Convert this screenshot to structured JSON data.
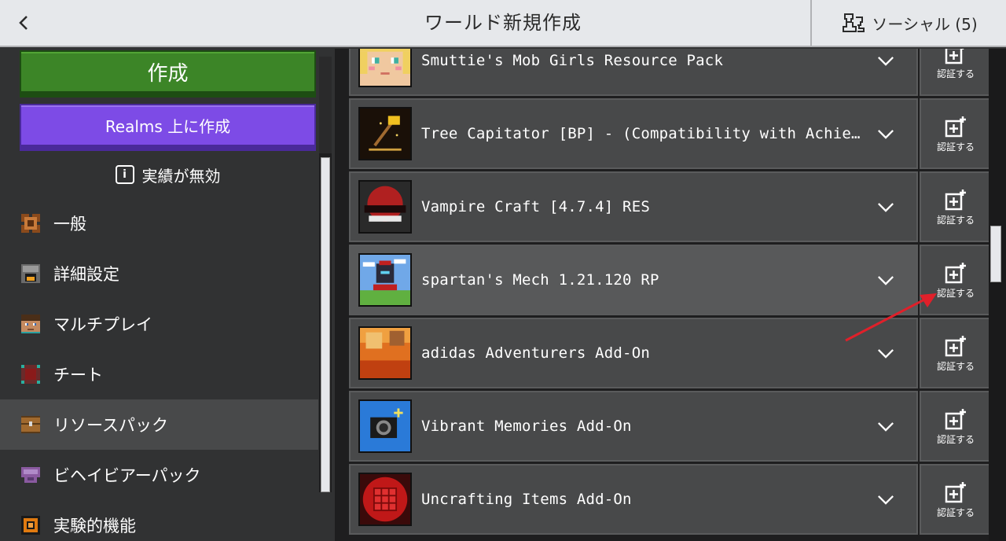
{
  "header": {
    "title": "ワールド新規作成",
    "social_label": "ソーシャル (5)"
  },
  "left": {
    "create_label": "作成",
    "realms_label": "Realms 上に作成",
    "achievements_label": "実績が無効",
    "achievements_icon": "info-icon",
    "nav": [
      {
        "label": "一般",
        "icon": "gear-icon",
        "active": false
      },
      {
        "label": "詳細設定",
        "icon": "furnace-icon",
        "active": false
      },
      {
        "label": "マルチプレイ",
        "icon": "player-head-icon",
        "active": false
      },
      {
        "label": "チート",
        "icon": "cheat-block-icon",
        "active": false
      },
      {
        "label": "リソースパック",
        "icon": "chest-icon",
        "active": true
      },
      {
        "label": "ビヘイビアーパック",
        "icon": "behavior-icon",
        "active": false
      },
      {
        "label": "実験的機能",
        "icon": "experiment-icon",
        "active": false
      }
    ]
  },
  "packs": {
    "button_label": "認証する",
    "items": [
      {
        "name": "Smuttie's Mob Girls Resource Pack",
        "thumb": "girl-face-thumb"
      },
      {
        "name": "Tree Capitator [BP] - (Compatibility with Achieveme...",
        "thumb": "axe-thumb"
      },
      {
        "name": "Vampire Craft [4.7.4] RES",
        "thumb": "vampire-craft-thumb"
      },
      {
        "name": "spartan's Mech 1.21.120 RP",
        "thumb": "spartan-thumb"
      },
      {
        "name": "adidas Adventurers Add-On",
        "thumb": "adidas-thumb"
      },
      {
        "name": "Vibrant Memories Add-On",
        "thumb": "camera-thumb"
      },
      {
        "name": "Uncrafting Items Add-On",
        "thumb": "crafting-grid-thumb"
      }
    ]
  },
  "colors": {
    "create_green": "#3c8527",
    "realms_purple": "#7d4be6",
    "header_bg": "#e6e8eb",
    "annotation_red": "#e0202a"
  }
}
